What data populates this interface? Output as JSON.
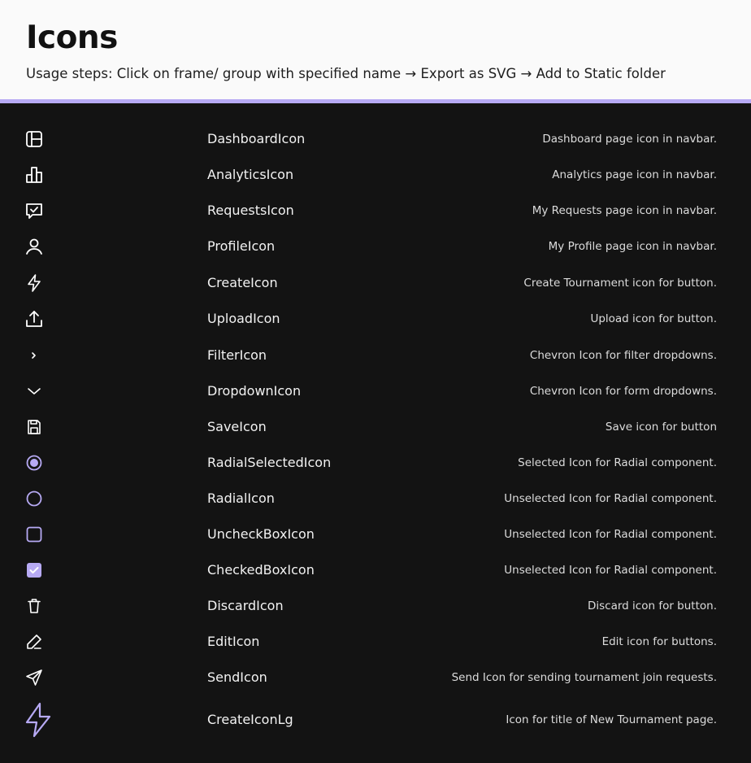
{
  "header": {
    "title": "Icons",
    "steps": "Usage steps: Click on frame/ group with specified name → Export as SVG → Add to Static folder"
  },
  "colors": {
    "background": "#131313",
    "header_bg": "#fafafa",
    "accent": "#b7aaf4",
    "text": "#f2f2f2"
  },
  "icons": [
    {
      "icon": "dashboard-icon",
      "name": "DashboardIcon",
      "desc": "Dashboard page icon in navbar."
    },
    {
      "icon": "analytics-icon",
      "name": "AnalyticsIcon",
      "desc": "Analytics page icon in navbar."
    },
    {
      "icon": "requests-icon",
      "name": "RequestsIcon",
      "desc": "My Requests page icon in navbar."
    },
    {
      "icon": "profile-icon",
      "name": "ProfileIcon",
      "desc": "My Profile page icon in navbar."
    },
    {
      "icon": "create-icon",
      "name": "CreateIcon",
      "desc": "Create Tournament icon for button."
    },
    {
      "icon": "upload-icon",
      "name": "UploadIcon",
      "desc": "Upload icon for button."
    },
    {
      "icon": "filter-icon",
      "name": "FilterIcon",
      "desc": "Chevron Icon for filter dropdowns."
    },
    {
      "icon": "dropdown-icon",
      "name": "DropdownIcon",
      "desc": "Chevron Icon for form dropdowns."
    },
    {
      "icon": "save-icon",
      "name": "SaveIcon",
      "desc": "Save icon for button"
    },
    {
      "icon": "radial-selected-icon",
      "name": "RadialSelectedIcon",
      "desc": "Selected Icon for Radial component."
    },
    {
      "icon": "radial-icon",
      "name": "RadialIcon",
      "desc": "Unselected Icon for Radial component."
    },
    {
      "icon": "uncheck-box-icon",
      "name": "UncheckBoxIcon",
      "desc": "Unselected Icon for Radial component."
    },
    {
      "icon": "checked-box-icon",
      "name": "CheckedBoxIcon",
      "desc": "Unselected Icon for Radial component."
    },
    {
      "icon": "discard-icon",
      "name": "DiscardIcon",
      "desc": "Discard icon for button."
    },
    {
      "icon": "edit-icon",
      "name": "EditIcon",
      "desc": "Edit icon for buttons."
    },
    {
      "icon": "send-icon",
      "name": "SendIcon",
      "desc": "Send Icon for sending tournament join requests."
    },
    {
      "icon": "create-icon-lg",
      "name": "CreateIconLg",
      "desc": "Icon for title of New Tournament page."
    }
  ]
}
